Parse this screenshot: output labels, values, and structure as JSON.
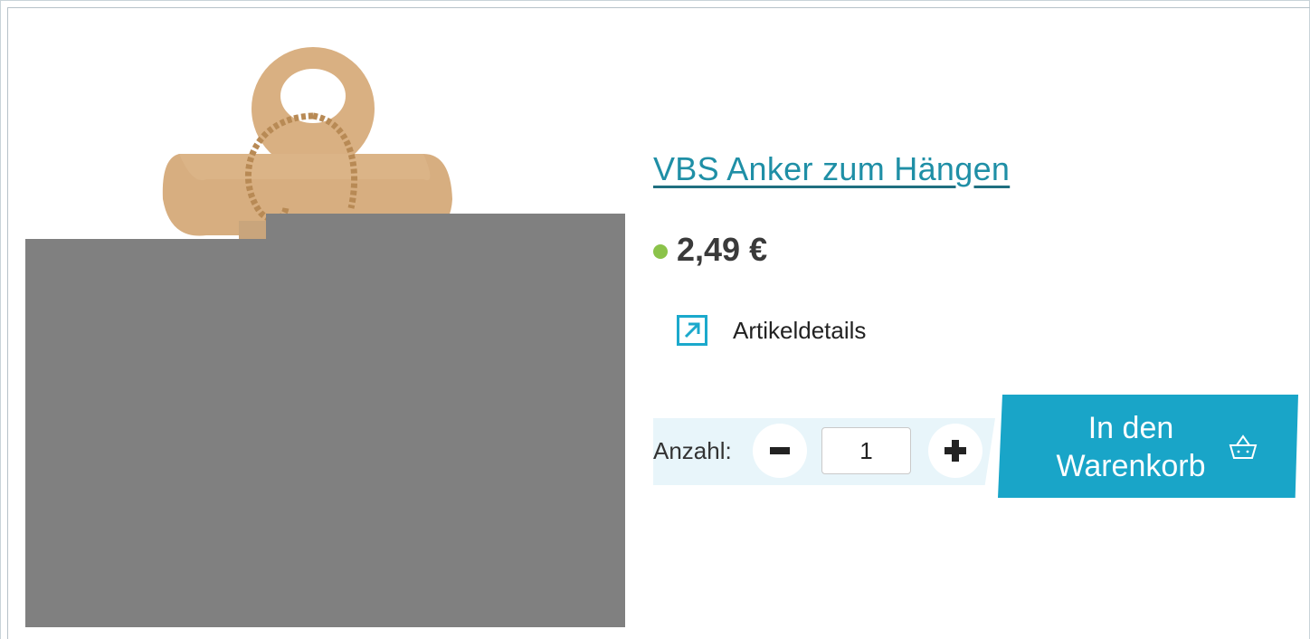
{
  "product": {
    "title": "VBS Anker zum Hängen",
    "price": "2,49 €",
    "availability_color": "#8bc34a"
  },
  "links": {
    "details_label": "Artikeldetails",
    "details_icon": "arrow-up-right-icon"
  },
  "quantity": {
    "label": "Anzahl:",
    "value": "1",
    "minus_icon": "minus-icon",
    "plus_icon": "plus-icon"
  },
  "cart": {
    "button_label": "In den\nWarenkorb",
    "icon": "basket-icon"
  },
  "colors": {
    "accent": "#19a5c8",
    "title_link": "#1f8fa6",
    "quantity_background": "#e8f5fa",
    "placeholder_gray": "#808080"
  }
}
